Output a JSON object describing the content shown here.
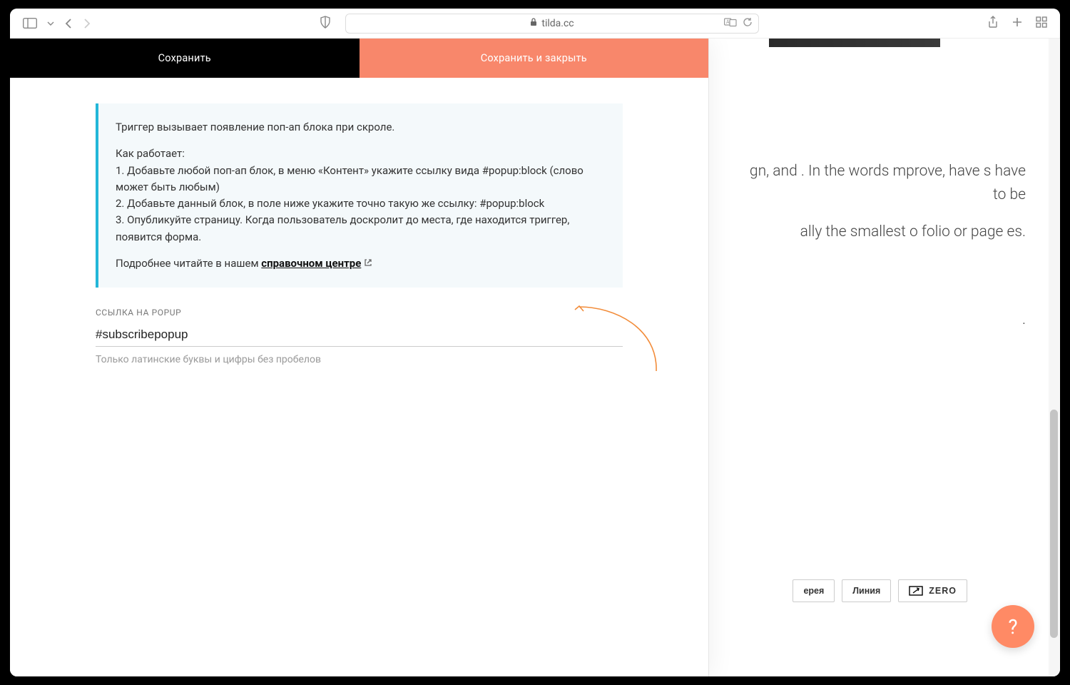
{
  "browser": {
    "url_host": "tilda.cc"
  },
  "panel": {
    "tabs": {
      "save": "Сохранить",
      "save_close": "Сохранить и закрыть"
    },
    "info": {
      "line1": "Триггер вызывает появление поп-ап блока при скроле.",
      "how_title": "Как работает:",
      "step1": "1. Добавьте любой поп-ап блок, в меню «Контент» укажите ссылку вида #popup:block (слово может быть любым)",
      "step2": "2. Добавьте данный блок, в поле ниже укажите точно такую же ссылку: #popup:block",
      "step3": "3. Опубликуйте страницу. Когда пользователь доскролит до места, где находится триггер, появится форма.",
      "more_prefix": "Подробнее читайте в нашем ",
      "more_link": "справочном центре"
    },
    "field": {
      "label": "ССЫЛКА НА POPUP",
      "value": "#subscribepopup",
      "hint": "Только латинские буквы и цифры без пробелов"
    }
  },
  "background": {
    "paragraph_fragment": "gn, and . In the words mprove, have s have to be",
    "paragraph_fragment2": "ally the smallest o folio or page es.",
    "period": ".",
    "tags": {
      "gallery": "ерея",
      "line": "Линия",
      "zero": "ZERO"
    }
  },
  "help": {
    "label": "?"
  }
}
